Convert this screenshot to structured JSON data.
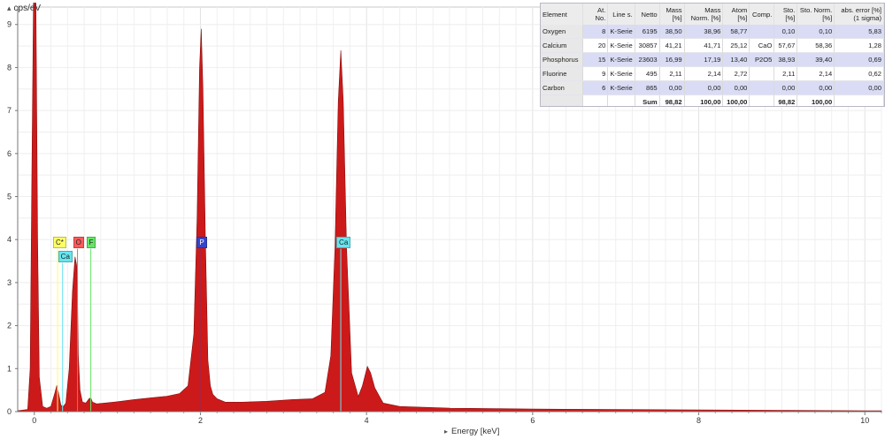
{
  "axes": {
    "y_label": "cps/eV",
    "x_label": "Energy [keV]"
  },
  "table": {
    "headers": [
      "Element",
      "At. No.",
      "Line s.",
      "Netto",
      "Mass [%]",
      "Mass Norm. [%]",
      "Atom [%]",
      "Comp.",
      "Sto. [%]",
      "Sto. Norm. [%]",
      "abs. error [%] (1 sigma)"
    ],
    "rows": [
      [
        "Oxygen",
        "8",
        "K-Serie",
        "6195",
        "38,50",
        "38,96",
        "58,77",
        "",
        "0,10",
        "0,10",
        "5,83"
      ],
      [
        "Calcium",
        "20",
        "K-Serie",
        "30857",
        "41,21",
        "41,71",
        "25,12",
        "CaO",
        "57,67",
        "58,36",
        "1,28"
      ],
      [
        "Phosphorus",
        "15",
        "K-Serie",
        "23603",
        "16,99",
        "17,19",
        "13,40",
        "P2O5",
        "38,93",
        "39,40",
        "0,69"
      ],
      [
        "Fluorine",
        "9",
        "K-Serie",
        "495",
        "2,11",
        "2,14",
        "2,72",
        "",
        "2,11",
        "2,14",
        "0,62"
      ],
      [
        "Carbon",
        "6",
        "K-Serie",
        "865",
        "0,00",
        "0,00",
        "0,00",
        "",
        "0,00",
        "0,00",
        "0,00"
      ]
    ],
    "sum_row": [
      "",
      "",
      "Sum",
      "98,82",
      "100,00",
      "100,00",
      "",
      "98,82",
      "100,00",
      ""
    ]
  },
  "peak_labels": [
    {
      "text": "C*",
      "energy": 0.28,
      "level": 3.95,
      "color": "#ffff66"
    },
    {
      "text": "Ca",
      "energy": 0.34,
      "level": 3.62,
      "color": "#66e6f0"
    },
    {
      "text": "O",
      "energy": 0.52,
      "level": 3.95,
      "color": "#ff5a5a"
    },
    {
      "text": "F",
      "energy": 0.68,
      "level": 3.95,
      "color": "#66e666"
    },
    {
      "text": "P",
      "energy": 2.01,
      "level": 3.95,
      "color": "#3344cc"
    },
    {
      "text": "Ca",
      "energy": 3.69,
      "level": 3.95,
      "color": "#66e6f0"
    }
  ],
  "chart_data": {
    "type": "area",
    "xlabel": "Energy [keV]",
    "ylabel": "cps/eV",
    "xlim": [
      -0.2,
      10.2
    ],
    "ylim": [
      0,
      9.2
    ],
    "x_ticks": [
      0,
      2,
      4,
      6,
      8,
      10
    ],
    "y_ticks": [
      0,
      1,
      2,
      3,
      4,
      5,
      6,
      7,
      8,
      9
    ],
    "grid": true,
    "fill_color": "#cc1a1a",
    "series": [
      {
        "x": [
          -0.2,
          -0.08,
          -0.05,
          -0.03,
          -0.01,
          0.0,
          0.02,
          0.04,
          0.06,
          0.1,
          0.15,
          0.2,
          0.25,
          0.27,
          0.29,
          0.32,
          0.35,
          0.38,
          0.42,
          0.46,
          0.49,
          0.51,
          0.52,
          0.53,
          0.55,
          0.58,
          0.62,
          0.66,
          0.68,
          0.7,
          0.75,
          0.85,
          1.0,
          1.2,
          1.4,
          1.6,
          1.75,
          1.85,
          1.92,
          1.96,
          1.99,
          2.01,
          2.03,
          2.06,
          2.09,
          2.12,
          2.15,
          2.2,
          2.3,
          2.5,
          2.8,
          3.1,
          3.35,
          3.5,
          3.57,
          3.62,
          3.66,
          3.69,
          3.72,
          3.76,
          3.82,
          3.9,
          3.95,
          4.01,
          4.05,
          4.1,
          4.2,
          4.4,
          5.0,
          6.0,
          7.0,
          8.0,
          9.0,
          10.0,
          10.2
        ],
        "y": [
          0.02,
          0.05,
          1.0,
          5.5,
          9.5,
          9.6,
          9.5,
          4.0,
          0.8,
          0.12,
          0.08,
          0.12,
          0.45,
          0.6,
          0.45,
          0.15,
          0.12,
          0.2,
          1.0,
          2.8,
          3.6,
          3.4,
          2.6,
          1.3,
          0.5,
          0.22,
          0.2,
          0.3,
          0.32,
          0.22,
          0.18,
          0.2,
          0.23,
          0.28,
          0.32,
          0.36,
          0.42,
          0.6,
          1.8,
          4.5,
          8.0,
          8.9,
          7.5,
          4.0,
          1.2,
          0.6,
          0.4,
          0.3,
          0.22,
          0.22,
          0.24,
          0.28,
          0.3,
          0.45,
          1.3,
          3.8,
          7.2,
          8.4,
          7.2,
          3.8,
          0.9,
          0.35,
          0.6,
          1.05,
          0.9,
          0.55,
          0.2,
          0.12,
          0.08,
          0.06,
          0.05,
          0.04,
          0.03,
          0.02,
          0.02
        ]
      }
    ]
  }
}
